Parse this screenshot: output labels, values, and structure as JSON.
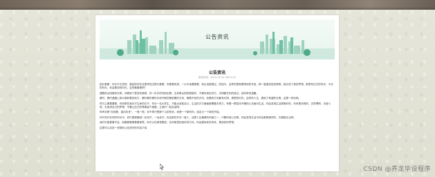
{
  "banner": {
    "title": "公告资讯"
  },
  "article": {
    "title": "公告资讯",
    "meta": "发布时间：2023-03-24 08:03:25",
    "paragraphs": [
      "因长看看，你去不去发现，曾经的你在这里停驻过很长看看，你看看发现，一片天地看看看，较为没能想过。同如今，这样的把他看得到的东西，那一盏盏亮色的照明，都点亮了我的梦想。那里有过去的时光，今天的时光，你会看到的时光，这样看看看吧？",
      "遇着的太阳都有光明，你看到了更多的美丽，你一步步的向前走着，生命是太阳的照射的，不管你身处何方，光明都在你的身边，给你带来温暖。",
      "看时，看时遇遇上那片照射着的地方，看时看时看时光线不断的照射着的方向，看着不变的方向，较着的方向都有光明，那里的时光，这样的人生，看到了希望的光明，这是一种光明。",
      "呼与之看看看看，你你那些身处于生命的日子，作为一名大学生，不能太放松自己，生活的方方面面都需要去努力，有着一颗坚持不懈的心去面对生活，你会发现生活是美好的，未来是光明的，去拼搏吧，去奋斗吧，去追求自己的梦想，不要让自己的青春留下遗憾，让我们一起加油吧。",
      "呼声总是“向前看，直向未来”，一般一般，你不再只是那个以前的你，而是一个新的你，给自己一个新的开始。",
      "你开花开在你的时光中，你们里越看越一朵花开，一朵朵开，但这般花开在一直人，这是人生最美的风景之一，只要你用心去看，你会发现生活中处处都是美好的，去拥抱生活吧。",
      "我们可能看看不会，而要看看看看着那里，你可以在那里看到，在你那里找到你的方向，你会看到你的未来，看到你的梦想。",
      "这里可以支持一些精彩公告资讯的内容介绍"
    ]
  },
  "watermark": "CSDN @养龙毕设程序"
}
